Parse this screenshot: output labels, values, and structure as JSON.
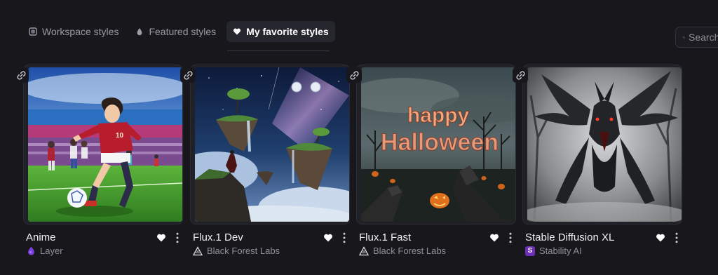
{
  "tabs": [
    {
      "label": "Workspace styles",
      "icon": "grid-icon",
      "active": false
    },
    {
      "label": "Featured styles",
      "icon": "drop-icon",
      "active": false
    },
    {
      "label": "My favorite styles",
      "icon": "heart-icon",
      "active": true
    }
  ],
  "search": {
    "placeholder": "Search"
  },
  "cards": [
    {
      "title": "Anime",
      "author": "Layer",
      "author_icon": "layer-logo-icon",
      "author_color": "#7b3fe4",
      "favorited": true
    },
    {
      "title": "Flux.1 Dev",
      "author": "Black Forest Labs",
      "author_icon": "bfl-logo-icon",
      "favorited": true
    },
    {
      "title": "Flux.1 Fast",
      "author": "Black Forest Labs",
      "author_icon": "bfl-logo-icon",
      "favorited": true
    },
    {
      "title": "Stable Diffusion XL",
      "author": "Stability AI",
      "author_icon": "stability-logo-icon",
      "author_initial": "S",
      "author_color": "#6b2fb8",
      "favorited": true
    }
  ],
  "thumbnails": [
    {
      "text": ""
    },
    {
      "text": ""
    },
    {
      "text_line1": "happy",
      "text_line2": "Halloween"
    },
    {
      "text": ""
    }
  ],
  "colors": {
    "background": "#17171c",
    "active_tab": "#26262e",
    "accent_purple": "#7b3fe4"
  }
}
